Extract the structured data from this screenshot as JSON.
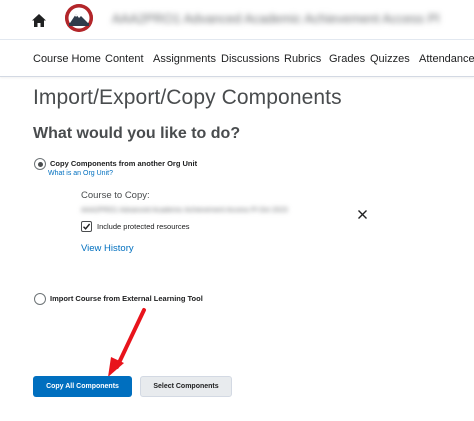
{
  "header": {
    "home_icon": "home-icon",
    "logo": "org-logo",
    "course_title": "AAA2PRO1 Advanced Academic Achievement Access Pl",
    "accent_color": "#b3262a"
  },
  "nav": {
    "items": [
      {
        "label": "Course Home"
      },
      {
        "label": "Content"
      },
      {
        "label": "Assignments"
      },
      {
        "label": "Discussions"
      },
      {
        "label": "Rubrics"
      },
      {
        "label": "Grades"
      },
      {
        "label": "Quizzes"
      },
      {
        "label": "Attendance"
      }
    ]
  },
  "page": {
    "title": "Import/Export/Copy Components",
    "question": "What would you like to do?"
  },
  "options": {
    "copy": {
      "label": "Copy Components from another Org Unit",
      "selected": true,
      "help_link": "What is an Org Unit?",
      "course_label": "Course to Copy:",
      "course_value": "AAA2PRO1 Advanced Academic Achievement Access Pl Oct 2023",
      "include_protected": "Include protected resources",
      "include_protected_checked": true,
      "view_history": "View History"
    },
    "import": {
      "label": "Import Course from External Learning Tool",
      "selected": false
    }
  },
  "buttons": {
    "primary": "Copy All Components",
    "secondary": "Select Components"
  },
  "colors": {
    "primary": "#006fbf",
    "link": "#006fbf",
    "annotation_arrow": "#e8141c"
  }
}
